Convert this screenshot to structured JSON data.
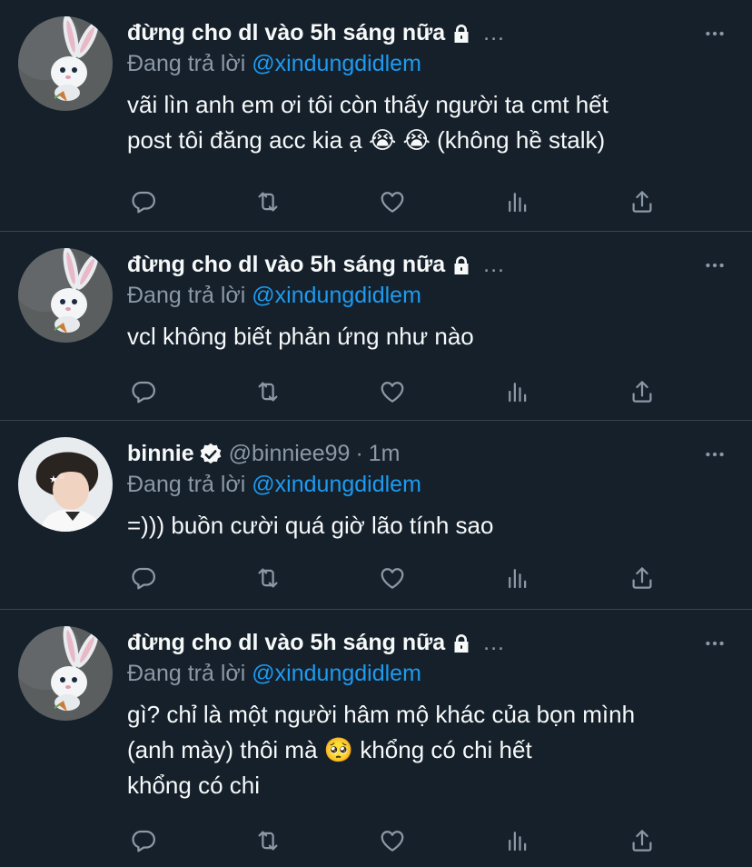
{
  "colors": {
    "background": "#15202b",
    "text": "#f7f9f9",
    "secondary": "#8b98a5",
    "link": "#1d9bf0",
    "divider": "#38444d"
  },
  "tweets": [
    {
      "name": "đừng cho dl vào 5h sáng nữa",
      "protected": true,
      "header_dots": "...",
      "reply_prefix": "Đang trả lời",
      "reply_handle": "@xindungdidlem",
      "text": "vãi lìn anh em ơi tôi còn thấy người ta cmt hết\npost tôi đăng acc kia ạ 😭 😭  (không hề stalk)",
      "avatar": "white-rabbit"
    },
    {
      "name": "đừng cho dl vào 5h sáng nữa",
      "protected": true,
      "header_dots": "...",
      "reply_prefix": "Đang trả lời",
      "reply_handle": "@xindungdidlem",
      "text": "vcl không biết phản ứng như nào",
      "avatar": "white-rabbit"
    },
    {
      "name": "binnie",
      "verified": true,
      "handle": "@binniee99",
      "separator": "·",
      "time": "1m",
      "reply_prefix": "Đang trả lời",
      "reply_handle": "@xindungdidlem",
      "text": "=))) buồn cười quá giờ lão tính sao",
      "avatar": "person-photo"
    },
    {
      "name": "đừng cho dl vào 5h sáng nữa",
      "protected": true,
      "header_dots": "...",
      "reply_prefix": "Đang trả lời",
      "reply_handle": "@xindungdidlem",
      "text": "gì? chỉ là một người hâm mộ khác của bọn mình\n(anh mày) thôi mà 🥺  khổng có chi hết\nkhổng có chi",
      "avatar": "white-rabbit"
    }
  ],
  "action_icons": [
    "reply-icon",
    "retweet-icon",
    "like-icon",
    "analytics-icon",
    "share-icon"
  ]
}
